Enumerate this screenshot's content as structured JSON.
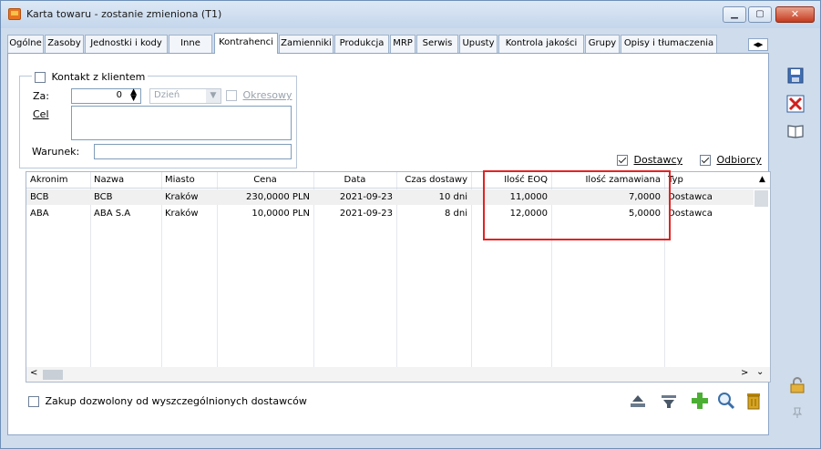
{
  "window": {
    "title": "Karta towaru - zostanie zmieniona (T1)"
  },
  "tabs": [
    "Ogólne",
    "Zasoby",
    "Jednostki i kody",
    "Inne",
    "Kontrahenci",
    "Zamienniki",
    "Produkcja",
    "MRP",
    "Serwis",
    "Upusty",
    "Kontrola jakości",
    "Grupy",
    "Opisy i tłumaczenia"
  ],
  "active_tab": "Kontrahenci",
  "kontakt": {
    "checkbox_label": "Kontakt z klientem",
    "za_label": "Za:",
    "za_value": "0",
    "unit_value": "Dzień",
    "okresowy_label": "Okresowy",
    "cel_label": "Cel",
    "cel_value": "",
    "warunek_label": "Warunek:",
    "warunek_value": ""
  },
  "filters": {
    "dostawcy_label": "Dostawcy",
    "dostawcy_checked": true,
    "odbiorcy_label": "Odbiorcy",
    "odbiorcy_checked": true
  },
  "table": {
    "columns": [
      "Akronim",
      "Nazwa",
      "Miasto",
      "Cena",
      "Data",
      "Czas dostawy",
      "Ilość EOQ",
      "Ilość zamawiana",
      "Typ"
    ],
    "rows": [
      [
        "BCB",
        "BCB",
        "Kraków",
        "230,0000 PLN",
        "2021-09-23",
        "10 dni",
        "11,0000",
        "7,0000",
        "Dostawca"
      ],
      [
        "ABA",
        "ABA S.A",
        "Kraków",
        "10,0000 PLN",
        "2021-09-23",
        "8 dni",
        "12,0000",
        "5,0000",
        "Dostawca"
      ]
    ]
  },
  "bottom": {
    "zakup_label": "Zakup dozwolony od wyszczególnionych dostawców",
    "zakup_checked": false
  },
  "colors": {
    "highlight": "#e32222",
    "window_bg": "#cfdcec",
    "accent": "#2f6fb8"
  }
}
